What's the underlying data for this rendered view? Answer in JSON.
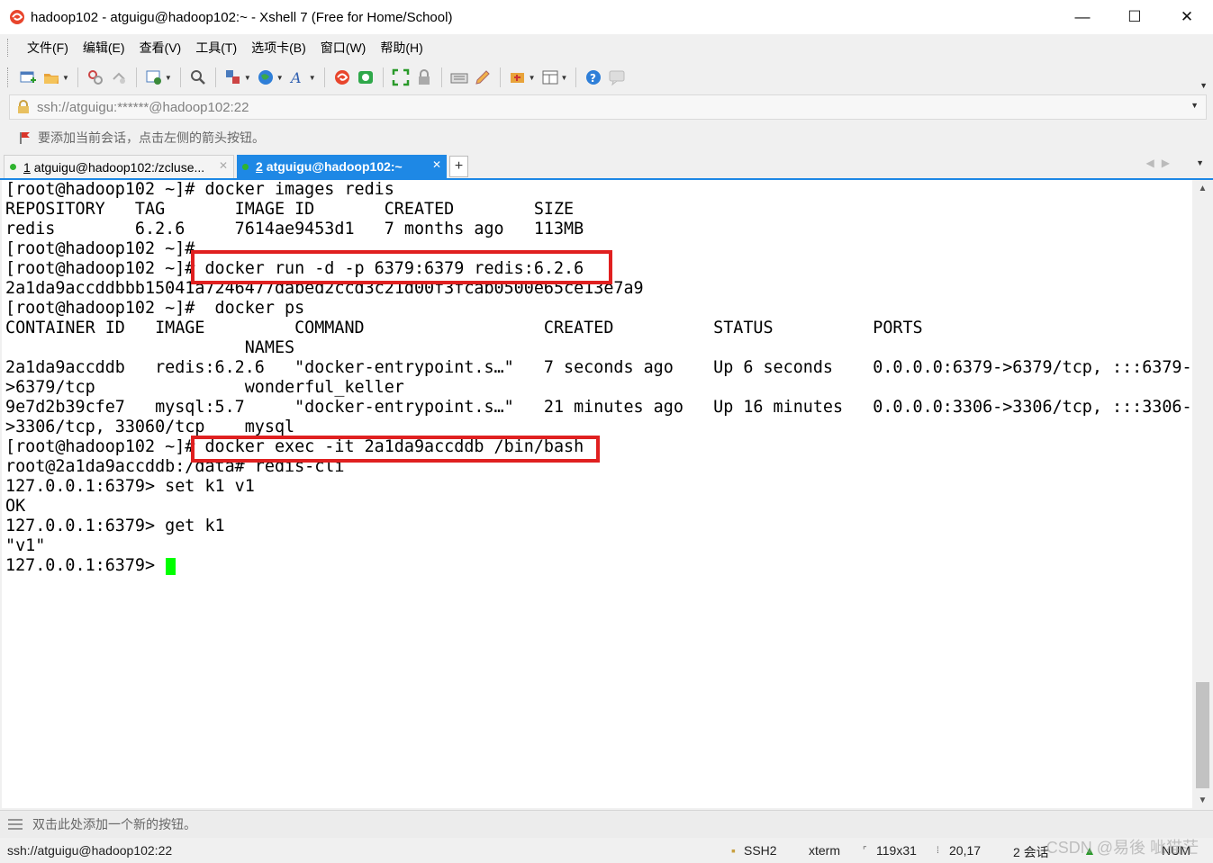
{
  "window": {
    "title": "hadoop102 - atguigu@hadoop102:~ - Xshell 7 (Free for Home/School)",
    "minimize_glyph": "—",
    "maximize_glyph": "☐",
    "close_glyph": "✕"
  },
  "menu": [
    "文件(F)",
    "编辑(E)",
    "查看(V)",
    "工具(T)",
    "选项卡(B)",
    "窗口(W)",
    "帮助(H)"
  ],
  "toolbar": {
    "icons": [
      "new-session-icon",
      "open-folder-icon",
      "disconnect-icon",
      "reconnect-icon",
      "properties-icon",
      "search-icon",
      "transfer-icon",
      "globe-icon",
      "font-icon",
      "xshell-icon",
      "xftp-icon",
      "fullscreen-icon",
      "lock-icon",
      "keyboard-icon",
      "compose-icon",
      "script-icon",
      "layout-icon",
      "help-icon",
      "chat-icon"
    ]
  },
  "address": {
    "value": "ssh://atguigu:******@hadoop102:22"
  },
  "session_hint": "要添加当前会话，点击左侧的箭头按钮。",
  "tabs": [
    {
      "number": "1",
      "label": "atguigu@hadoop102:/zcluse...",
      "active": false
    },
    {
      "number": "2",
      "label": "atguigu@hadoop102:~",
      "active": true
    }
  ],
  "tab_add": "+",
  "terminal": {
    "lines": [
      "[root@hadoop102 ~]# docker images redis",
      "REPOSITORY   TAG       IMAGE ID       CREATED        SIZE",
      "redis        6.2.6     7614ae9453d1   7 months ago   113MB",
      "[root@hadoop102 ~]#",
      "[root@hadoop102 ~]# docker run -d -p 6379:6379 redis:6.2.6",
      "2a1da9accddbbb15041a7246477dabed2ccd3c21d00f3fcab0500e65ce13e7a9",
      "[root@hadoop102 ~]#  docker ps",
      "CONTAINER ID   IMAGE         COMMAND                  CREATED          STATUS          PORTS",
      "                        NAMES",
      "2a1da9accddb   redis:6.2.6   \"docker-entrypoint.s…\"   7 seconds ago    Up 6 seconds    0.0.0.0:6379->6379/tcp, :::6379-",
      ">6379/tcp               wonderful_keller",
      "9e7d2b39cfe7   mysql:5.7     \"docker-entrypoint.s…\"   21 minutes ago   Up 16 minutes   0.0.0.0:3306->3306/tcp, :::3306-",
      ">3306/tcp, 33060/tcp    mysql",
      "[root@hadoop102 ~]# docker exec -it 2a1da9accddb /bin/bash",
      "root@2a1da9accddb:/data# redis-cli",
      "127.0.0.1:6379> set k1 v1",
      "OK",
      "127.0.0.1:6379> get k1",
      "\"v1\"",
      "127.0.0.1:6379> "
    ]
  },
  "quickbar": {
    "text": "双击此处添加一个新的按钮。"
  },
  "status": {
    "connection": "ssh://atguigu@hadoop102:22",
    "protocol": "SSH2",
    "term": "xterm",
    "size": "119x31",
    "cursor_pos": "20,17",
    "sessions": "2 会话",
    "num": "NUM"
  },
  "watermark": "CSDN @易後 呲猫茫",
  "colors": {
    "tab_active": "#1e88e5",
    "highlight_box": "#e02020",
    "cursor": "#00ff00"
  }
}
